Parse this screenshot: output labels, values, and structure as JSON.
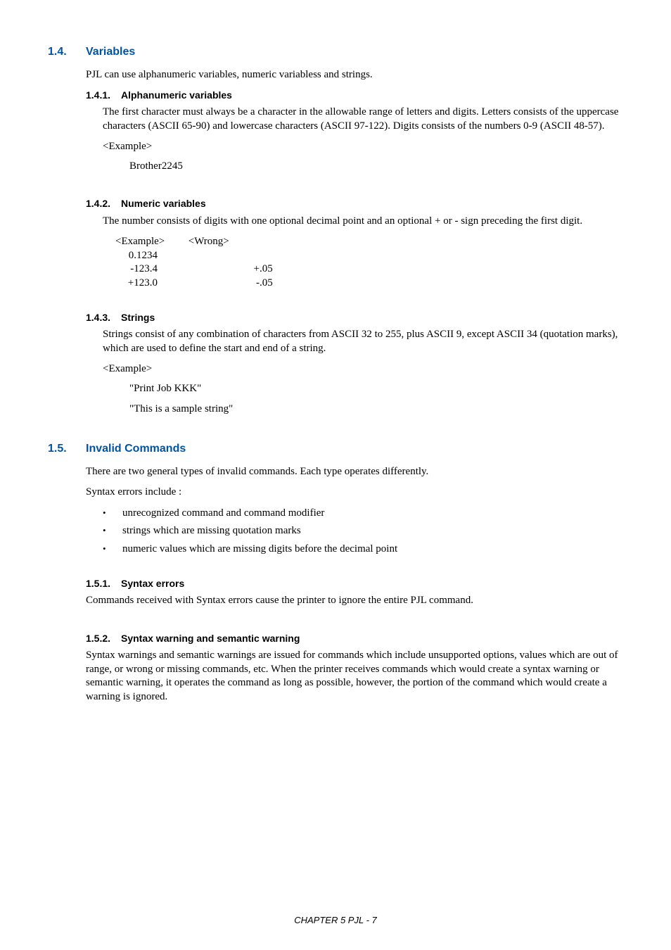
{
  "s14": {
    "num": "1.4.",
    "title": "Variables",
    "intro": "PJL can use alphanumeric variables, numeric variabless and strings.",
    "s1": {
      "num": "1.4.1.",
      "title": "Alphanumeric variables",
      "body": "The first character must always be a character in the allowable range of letters and digits.  Letters consists of the uppercase characters (ASCII 65-90) and lowercase characters (ASCII 97-122).  Digits consists of the numbers 0-9 (ASCII 48-57).",
      "example_label": "<Example>",
      "example_value": "Brother2245"
    },
    "s2": {
      "num": "1.4.2.",
      "title": "Numeric variables",
      "body": "The number consists of digits with one optional decimal point and an optional + or - sign preceding the first digit.",
      "col1_head": "<Example>",
      "col2_head": "<Wrong>",
      "rows": {
        "r0a": "0.1234",
        "r0b": "",
        "r1a": "-123.4",
        "r1b": "+.05",
        "r2a": "+123.0",
        "r2b": "-.05"
      }
    },
    "s3": {
      "num": "1.4.3.",
      "title": "Strings",
      "body": "Strings consist of any combination of characters from ASCII 32 to 255, plus ASCII 9, except ASCII 34 (quotation marks), which are used to define the start and end of a string.",
      "example_label": "<Example>",
      "ex1": "\"Print Job  KKK\"",
      "ex2": "\"This is a sample string\""
    }
  },
  "s15": {
    "num": "1.5.",
    "title": "Invalid Commands",
    "intro1": "There are two general types of invalid commands.  Each type operates differently.",
    "intro2": "Syntax errors include :",
    "bullets": {
      "b0": "unrecognized command and command modifier",
      "b1": "strings which are missing quotation marks",
      "b2": "numeric values which are missing digits before the decimal point"
    },
    "s1": {
      "num": "1.5.1.",
      "title": "Syntax errors",
      "body": "Commands received with Syntax errors cause the printer to ignore the entire PJL command."
    },
    "s2": {
      "num": "1.5.2.",
      "title": "Syntax warning and semantic warning",
      "body": "Syntax warnings and semantic warnings are issued for commands which include unsupported options, values which are out of range, or wrong  or missing commands, etc.  When the printer receives commands which would create a syntax warning or semantic warning, it operates the command as long as possible, however, the  portion of the command which would create a  warning is ignored."
    }
  },
  "footer": "CHAPTER 5 PJL - 7"
}
